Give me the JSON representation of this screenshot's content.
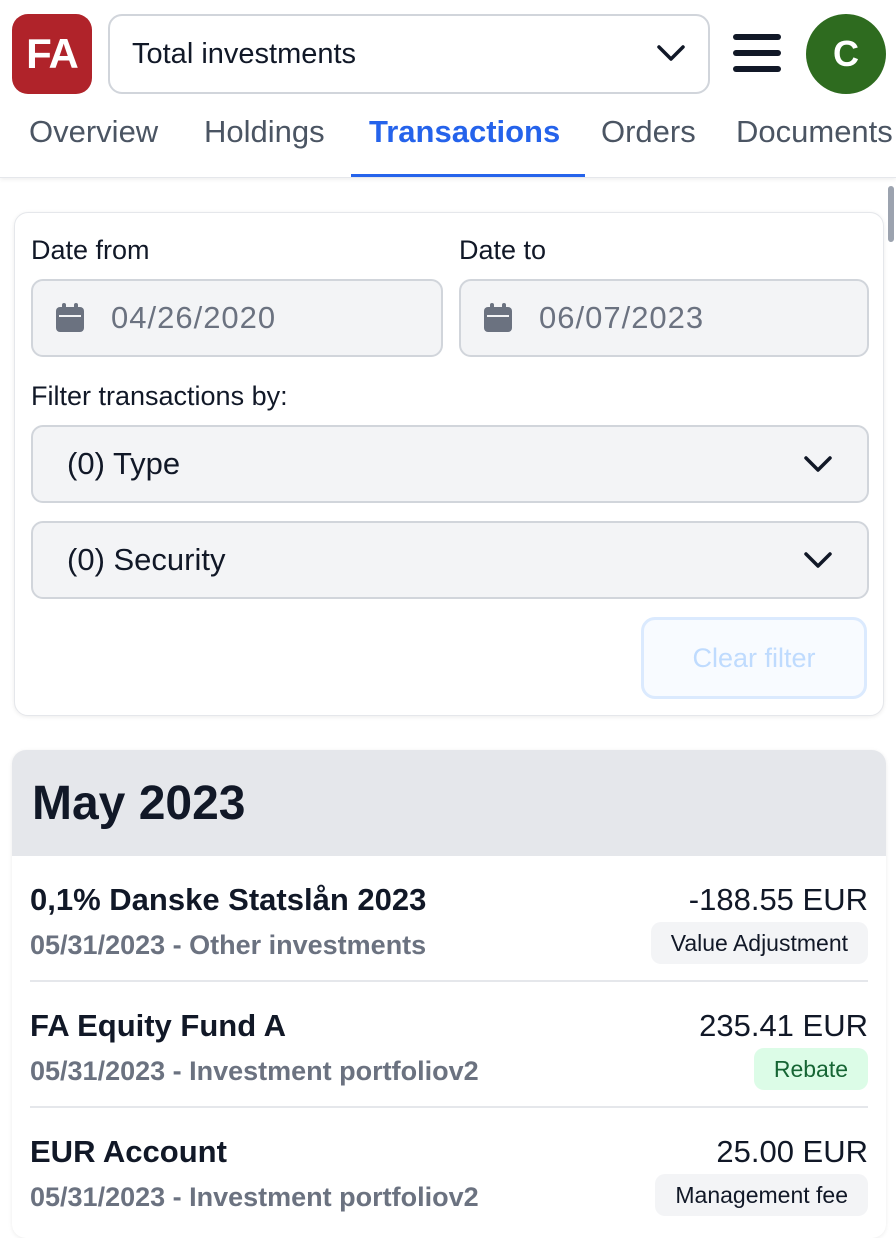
{
  "header": {
    "logo_text": "FA",
    "selector_value": "Total investments",
    "avatar_initial": "C"
  },
  "tabs": [
    {
      "label": "Overview"
    },
    {
      "label": "Holdings"
    },
    {
      "label": "Transactions"
    },
    {
      "label": "Orders"
    },
    {
      "label": "Documents"
    }
  ],
  "active_tab": "Transactions",
  "filters": {
    "date_from_label": "Date from",
    "date_from_value": "04/26/2020",
    "date_to_label": "Date to",
    "date_to_value": "06/07/2023",
    "filter_by_label": "Filter transactions by:",
    "type_select": "(0) Type",
    "security_select": "(0) Security",
    "clear_label": "Clear filter"
  },
  "transactions": {
    "month": "May 2023",
    "rows": [
      {
        "name": "0,1% Danske Statslån 2023",
        "sub": "05/31/2023 - Other investments",
        "amount": "-188.55 EUR",
        "type": "Value Adjustment"
      },
      {
        "name": "FA Equity Fund A",
        "sub": "05/31/2023 - Investment portfoliov2",
        "amount": "235.41 EUR",
        "type": "Rebate"
      },
      {
        "name": "EUR Account",
        "sub": "05/31/2023 - Investment portfoliov2",
        "amount": "25.00 EUR",
        "type": "Management fee"
      }
    ]
  },
  "colors": {
    "accent": "#2563eb",
    "logo": "#b0232a",
    "avatar": "#2e6b1f",
    "rebate_badge_bg": "#dcfce7",
    "rebate_badge_text": "#166534"
  },
  "icons": [
    "chevron-down-icon",
    "menu-icon",
    "calendar-icon"
  ]
}
